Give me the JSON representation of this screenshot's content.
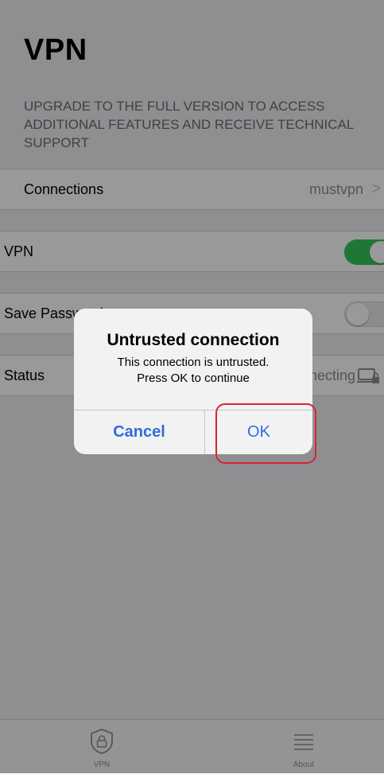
{
  "header": {
    "title": "VPN",
    "upgrade_note": "UPGRADE TO THE FULL VERSION TO ACCESS ADDITIONAL FEATURES AND RECEIVE TECHNICAL SUPPORT"
  },
  "settings": {
    "connections": {
      "label": "Connections",
      "value": "mustvpn",
      "chevron": ">"
    },
    "vpn": {
      "label": "VPN",
      "enabled": true
    },
    "save_password": {
      "label": "Save Password",
      "enabled": false
    },
    "status": {
      "label": "Status",
      "value": "Connecting",
      "icon": "computer-lock-icon"
    }
  },
  "dialog": {
    "title": "Untrusted connection",
    "message_line1": "This connection is untrusted.",
    "message_line2": "Press OK to continue",
    "cancel_label": "Cancel",
    "ok_label": "OK"
  },
  "tabbar": {
    "tabs": [
      {
        "label": "VPN",
        "icon": "shield-lock-icon"
      },
      {
        "label": "About",
        "icon": "list-icon"
      }
    ]
  },
  "colors": {
    "toggle_on": "#34c759",
    "accent": "#2f6ddc",
    "highlight": "#d62433",
    "background": "#efeff4"
  }
}
